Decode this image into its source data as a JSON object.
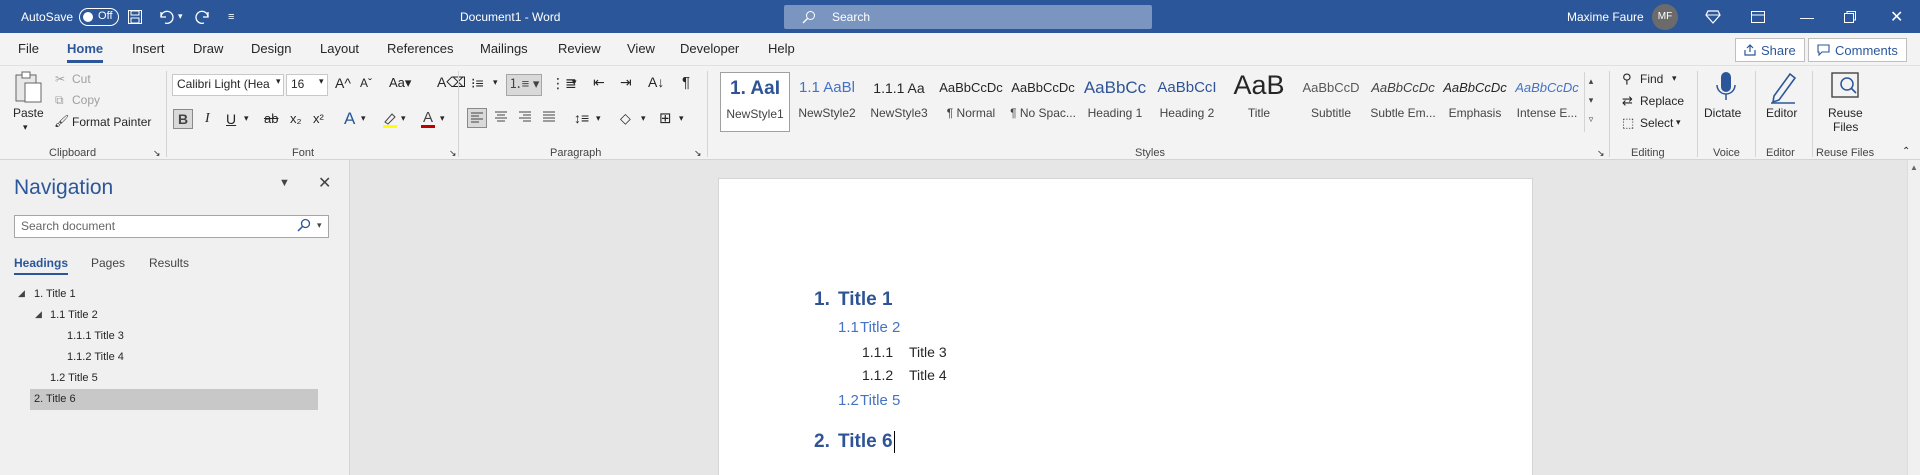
{
  "titlebar": {
    "autosave_label": "AutoSave",
    "autosave_state": "Off",
    "doc_title": "Document1  -  Word",
    "search_placeholder": "Search",
    "user_name": "Maxime Faure",
    "user_initials": "MF"
  },
  "menu": {
    "tabs": [
      "File",
      "Home",
      "Insert",
      "Draw",
      "Design",
      "Layout",
      "References",
      "Mailings",
      "Review",
      "View",
      "Developer",
      "Help"
    ],
    "share": "Share",
    "comments": "Comments"
  },
  "ribbon": {
    "clipboard": {
      "paste": "Paste",
      "cut": "Cut",
      "copy": "Copy",
      "format_painter": "Format Painter",
      "group": "Clipboard"
    },
    "font": {
      "name": "Calibri Light (Hea",
      "size": "16",
      "group": "Font"
    },
    "paragraph": {
      "group": "Paragraph"
    },
    "styles": {
      "group": "Styles",
      "items": [
        {
          "preview": "1.  AaI",
          "label": "NewStyle1"
        },
        {
          "preview": "1.1  AaBl",
          "label": "NewStyle2"
        },
        {
          "preview": "1.1.1  Aa",
          "label": "NewStyle3"
        },
        {
          "preview": "AaBbCcDc",
          "label": "¶ Normal"
        },
        {
          "preview": "AaBbCcDc",
          "label": "¶ No Spac..."
        },
        {
          "preview": "AaBbCc",
          "label": "Heading 1"
        },
        {
          "preview": "AaBbCcI",
          "label": "Heading 2"
        },
        {
          "preview": "AaB",
          "label": "Title"
        },
        {
          "preview": "AaBbCcD",
          "label": "Subtitle"
        },
        {
          "preview": "AaBbCcDc",
          "label": "Subtle Em..."
        },
        {
          "preview": "AaBbCcDc",
          "label": "Emphasis"
        },
        {
          "preview": "AaBbCcDc",
          "label": "Intense E..."
        }
      ]
    },
    "editing": {
      "find": "Find",
      "replace": "Replace",
      "select": "Select",
      "group": "Editing"
    },
    "voice": {
      "dictate": "Dictate",
      "group": "Voice"
    },
    "editor": {
      "editor": "Editor",
      "group": "Editor"
    },
    "reuse": {
      "reuse_line1": "Reuse",
      "reuse_line2": "Files",
      "group": "Reuse Files"
    }
  },
  "navigation": {
    "title": "Navigation",
    "search_placeholder": "Search document",
    "tabs": [
      "Headings",
      "Pages",
      "Results"
    ],
    "headings": [
      "1. Title 1",
      "1.1 Title 2",
      "1.1.1 Title 3",
      "1.1.2 Title 4",
      "1.2 Title 5",
      "2. Title 6"
    ]
  },
  "document": {
    "h1a_num": "1.",
    "h1a_text": "Title 1",
    "h2a_num": "1.1",
    "h2a_text": "Title 2",
    "h3a_num": "1.1.1",
    "h3a_text": "Title 3",
    "h3b_num": "1.1.2",
    "h3b_text": "Title 4",
    "h2b_num": "1.2",
    "h2b_text": "Title 5",
    "h1b_num": "2.",
    "h1b_text": "Title 6"
  },
  "colors": {
    "accent": "#2b579a",
    "heading": "#2f5496",
    "heading2": "#4472c4"
  }
}
